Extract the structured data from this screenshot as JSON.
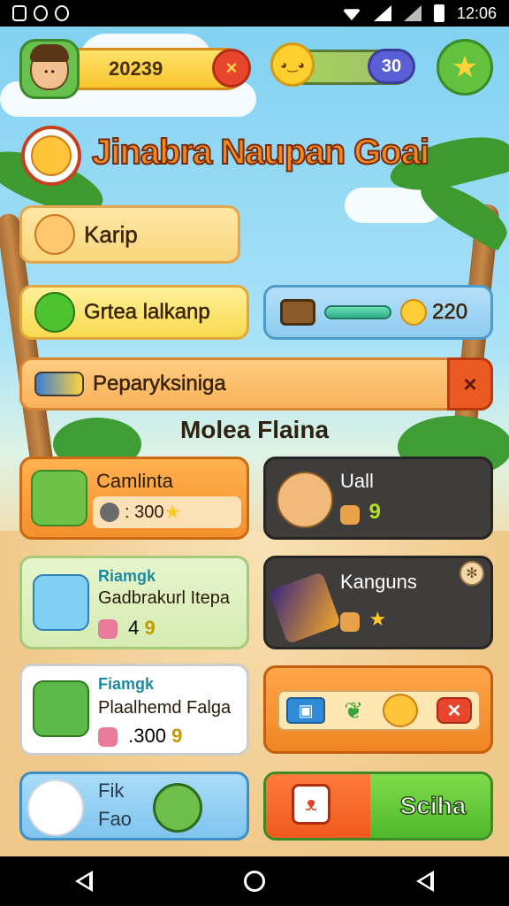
{
  "status_bar": {
    "time": "12:06"
  },
  "hud": {
    "coins": "20239",
    "coins_close": "×",
    "energy": "30"
  },
  "title": "Jinabra Naupan Goai",
  "panels": {
    "karip": "Karip",
    "green": "Grtea lalkanp",
    "blue_value": "220",
    "orange": "Peparyksiniga",
    "orange_close": "×"
  },
  "section_title": "Molea Flaina",
  "cards": {
    "c1": {
      "title": "Camlinta",
      "price": ": 300"
    },
    "c2": {
      "title": "Uall",
      "value": "9"
    },
    "c3": {
      "subtitle": "Riamgk",
      "title": "Gadbrakurl Itepa",
      "value": "4",
      "value2": "9"
    },
    "c4": {
      "title": "Kanguns"
    },
    "c5": {
      "subtitle": "Fiamgk",
      "title": "Plaalhemd Falga",
      "value": ".300",
      "value2": "9"
    },
    "c7": {
      "line1": "Fik",
      "line2": "Fao"
    },
    "c8": {
      "label": "Sciha"
    }
  },
  "colors": {
    "accent_orange": "#f38f2c",
    "accent_green": "#62c23f",
    "title_orange": "#f08a1e"
  }
}
